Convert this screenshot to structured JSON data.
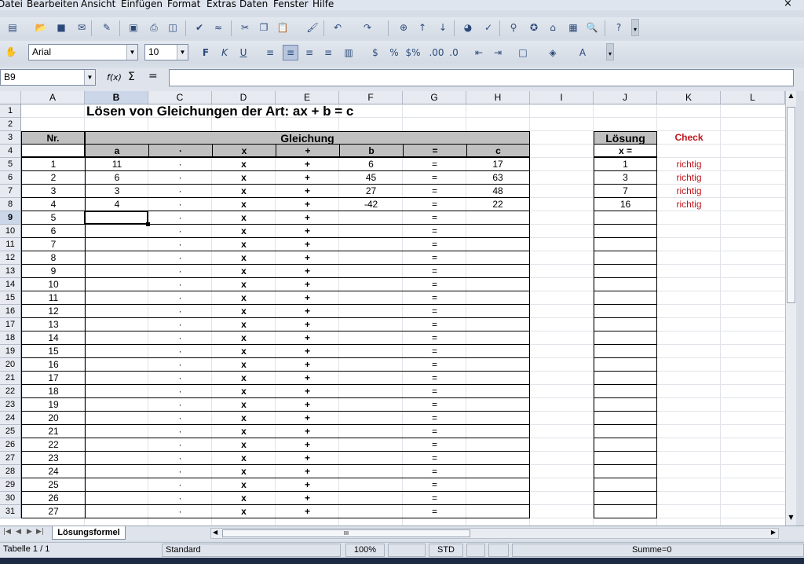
{
  "menu": [
    "Datei",
    "Bearbeiten",
    "Ansicht",
    "Einfügen",
    "Format",
    "Extras",
    "Daten",
    "Fenster",
    "Hilfe"
  ],
  "window": {
    "close_glyph": "×"
  },
  "format": {
    "font_name": "Arial",
    "font_size": "10"
  },
  "formula_bar": {
    "name_box": "B9",
    "function_wizard": "f(x)",
    "sum_glyph": "Σ",
    "equals_glyph": "=",
    "content": ""
  },
  "columns": [
    "A",
    "B",
    "C",
    "D",
    "E",
    "F",
    "G",
    "H",
    "I",
    "J",
    "K",
    "L"
  ],
  "selected_column": "B",
  "selected_row": 9,
  "sheet": {
    "title": "Lösen von Gleichungen der Art:    ax + b = c",
    "header_nr": "Nr.",
    "header_gleichung": "Gleichung",
    "header_loesung": "Lösung",
    "header_check": "Check",
    "sub_a": "a",
    "sub_dot": "·",
    "sub_x": "x",
    "sub_plus": "+",
    "sub_b": "b",
    "sub_eq": "=",
    "sub_c": "c",
    "sub_xeq": "x =",
    "rows": [
      {
        "nr": "1",
        "a": "11",
        "b": "6",
        "c": "17",
        "x": "1",
        "check": "richtig"
      },
      {
        "nr": "2",
        "a": "6",
        "b": "45",
        "c": "63",
        "x": "3",
        "check": "richtig"
      },
      {
        "nr": "3",
        "a": "3",
        "b": "27",
        "c": "48",
        "x": "7",
        "check": "richtig"
      },
      {
        "nr": "4",
        "a": "4",
        "b": "-42",
        "c": "22",
        "x": "16",
        "check": "richtig"
      },
      {
        "nr": "5",
        "a": "",
        "b": "",
        "c": "",
        "x": "",
        "check": ""
      },
      {
        "nr": "6",
        "a": "",
        "b": "",
        "c": "",
        "x": "",
        "check": ""
      },
      {
        "nr": "7",
        "a": "",
        "b": "",
        "c": "",
        "x": "",
        "check": ""
      },
      {
        "nr": "8",
        "a": "",
        "b": "",
        "c": "",
        "x": "",
        "check": ""
      },
      {
        "nr": "9",
        "a": "",
        "b": "",
        "c": "",
        "x": "",
        "check": ""
      },
      {
        "nr": "10",
        "a": "",
        "b": "",
        "c": "",
        "x": "",
        "check": ""
      },
      {
        "nr": "11",
        "a": "",
        "b": "",
        "c": "",
        "x": "",
        "check": ""
      },
      {
        "nr": "12",
        "a": "",
        "b": "",
        "c": "",
        "x": "",
        "check": ""
      },
      {
        "nr": "13",
        "a": "",
        "b": "",
        "c": "",
        "x": "",
        "check": ""
      },
      {
        "nr": "14",
        "a": "",
        "b": "",
        "c": "",
        "x": "",
        "check": ""
      },
      {
        "nr": "15",
        "a": "",
        "b": "",
        "c": "",
        "x": "",
        "check": ""
      },
      {
        "nr": "16",
        "a": "",
        "b": "",
        "c": "",
        "x": "",
        "check": ""
      },
      {
        "nr": "17",
        "a": "",
        "b": "",
        "c": "",
        "x": "",
        "check": ""
      },
      {
        "nr": "18",
        "a": "",
        "b": "",
        "c": "",
        "x": "",
        "check": ""
      },
      {
        "nr": "19",
        "a": "",
        "b": "",
        "c": "",
        "x": "",
        "check": ""
      },
      {
        "nr": "20",
        "a": "",
        "b": "",
        "c": "",
        "x": "",
        "check": ""
      },
      {
        "nr": "21",
        "a": "",
        "b": "",
        "c": "",
        "x": "",
        "check": ""
      },
      {
        "nr": "22",
        "a": "",
        "b": "",
        "c": "",
        "x": "",
        "check": ""
      },
      {
        "nr": "23",
        "a": "",
        "b": "",
        "c": "",
        "x": "",
        "check": ""
      },
      {
        "nr": "24",
        "a": "",
        "b": "",
        "c": "",
        "x": "",
        "check": ""
      },
      {
        "nr": "25",
        "a": "",
        "b": "",
        "c": "",
        "x": "",
        "check": ""
      },
      {
        "nr": "26",
        "a": "",
        "b": "",
        "c": "",
        "x": "",
        "check": ""
      },
      {
        "nr": "27",
        "a": "",
        "b": "",
        "c": "",
        "x": "",
        "check": ""
      }
    ]
  },
  "colors": {
    "check_red": "#c0161e",
    "header_gray": "#c0c0c0"
  },
  "sheet_tab": "Lösungsformel",
  "scroll_glyph": "III",
  "status": {
    "sheet": "Tabelle 1 / 1",
    "style": "Standard",
    "zoom": "100%",
    "mode": "STD",
    "sum": "Summe=0"
  }
}
